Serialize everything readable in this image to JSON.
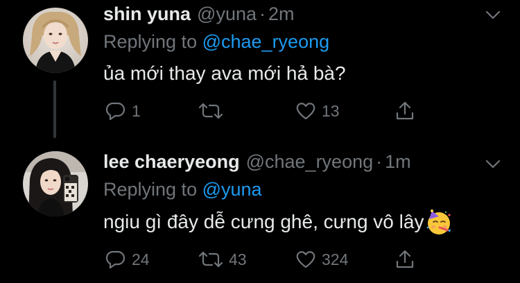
{
  "tweets": [
    {
      "display_name": "shin yuna",
      "handle": "@yuna",
      "separator": "·",
      "time": "2m",
      "replying_prefix": "Replying to ",
      "replying_to": "@chae_ryeong",
      "text": "ủa mới thay ava mới hả bà?",
      "emoji": "",
      "reply_count": "1",
      "retweet_count": "",
      "like_count": "13"
    },
    {
      "display_name": "lee chaeryeong",
      "handle": "@chae_ryeong",
      "separator": "·",
      "time": "1m",
      "replying_prefix": "Replying to ",
      "replying_to": "@yuna",
      "text": "ngiu gì đây dễ cưng ghê, cưng vô lây",
      "emoji": "partying-face",
      "reply_count": "24",
      "retweet_count": "43",
      "like_count": "324"
    }
  ],
  "colors": {
    "background": "#000000",
    "primary_text": "#e7e9ea",
    "secondary_text": "#71767b",
    "link": "#1d9bf0",
    "thread_line": "#333639"
  },
  "icons": {
    "reply": "reply-icon",
    "retweet": "retweet-icon",
    "like": "like-icon",
    "share": "share-icon",
    "more": "chevron-down-icon"
  }
}
